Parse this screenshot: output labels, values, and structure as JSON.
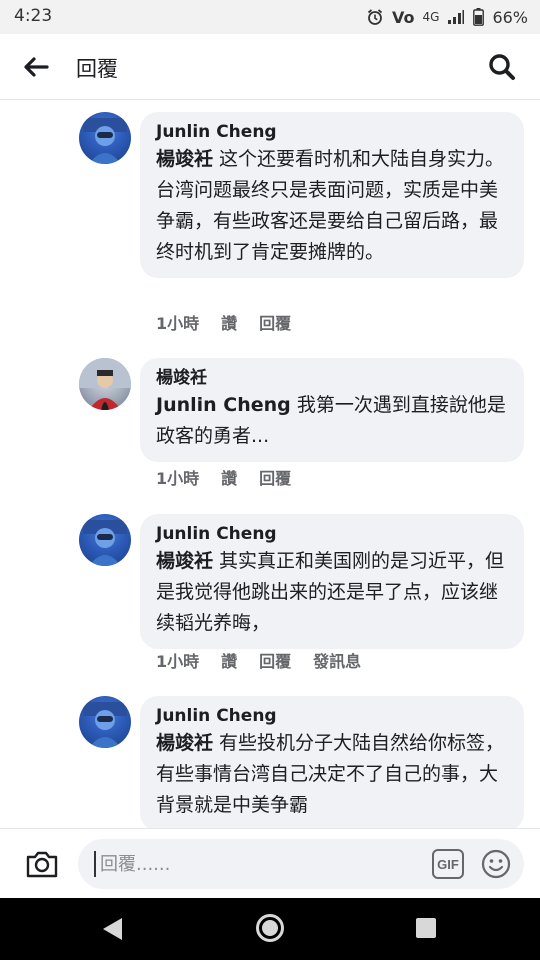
{
  "status_bar": {
    "time": "4:23",
    "volte": "Vo",
    "network": "4G",
    "battery": "66%"
  },
  "header": {
    "title": "回覆"
  },
  "comments": [
    {
      "author": "Junlin Cheng",
      "mention": "楊竣衽",
      "text": " 这个还要看时机和大陆自身实力。台湾问题最终只是表面问题，实质是中美争霸，有些政客还是要给自己留后路，最终时机到了肯定要摊牌的。",
      "time": "1小時",
      "like": "讚",
      "reply": "回覆"
    },
    {
      "author": "楊竣衽",
      "mention": "Junlin Cheng",
      "text": " 我第一次遇到直接說他是政客的勇者...",
      "time": "1小時",
      "like": "讚",
      "reply": "回覆"
    },
    {
      "author": "Junlin Cheng",
      "mention": "楊竣衽",
      "text": " 其实真正和美国刚的是习近平，但是我觉得他跳出来的还是早了点，应该继续韬光养晦，",
      "time": "1小時",
      "like": "讚",
      "reply": "回覆",
      "message": "發訊息"
    },
    {
      "author": "Junlin Cheng",
      "mention": "楊竣衽",
      "text": " 有些投机分子大陆自然给你标签，有些事情台湾自己决定不了自己的事，大背景就是中美争霸"
    }
  ],
  "composer": {
    "placeholder": "回覆......",
    "gif_label": "GIF"
  },
  "icons": {
    "back": "arrow-left-icon",
    "search": "search-icon",
    "camera": "camera-icon",
    "emoji": "emoji-icon",
    "alarm": "alarm-icon",
    "signal": "signal-icon",
    "battery": "battery-icon"
  }
}
